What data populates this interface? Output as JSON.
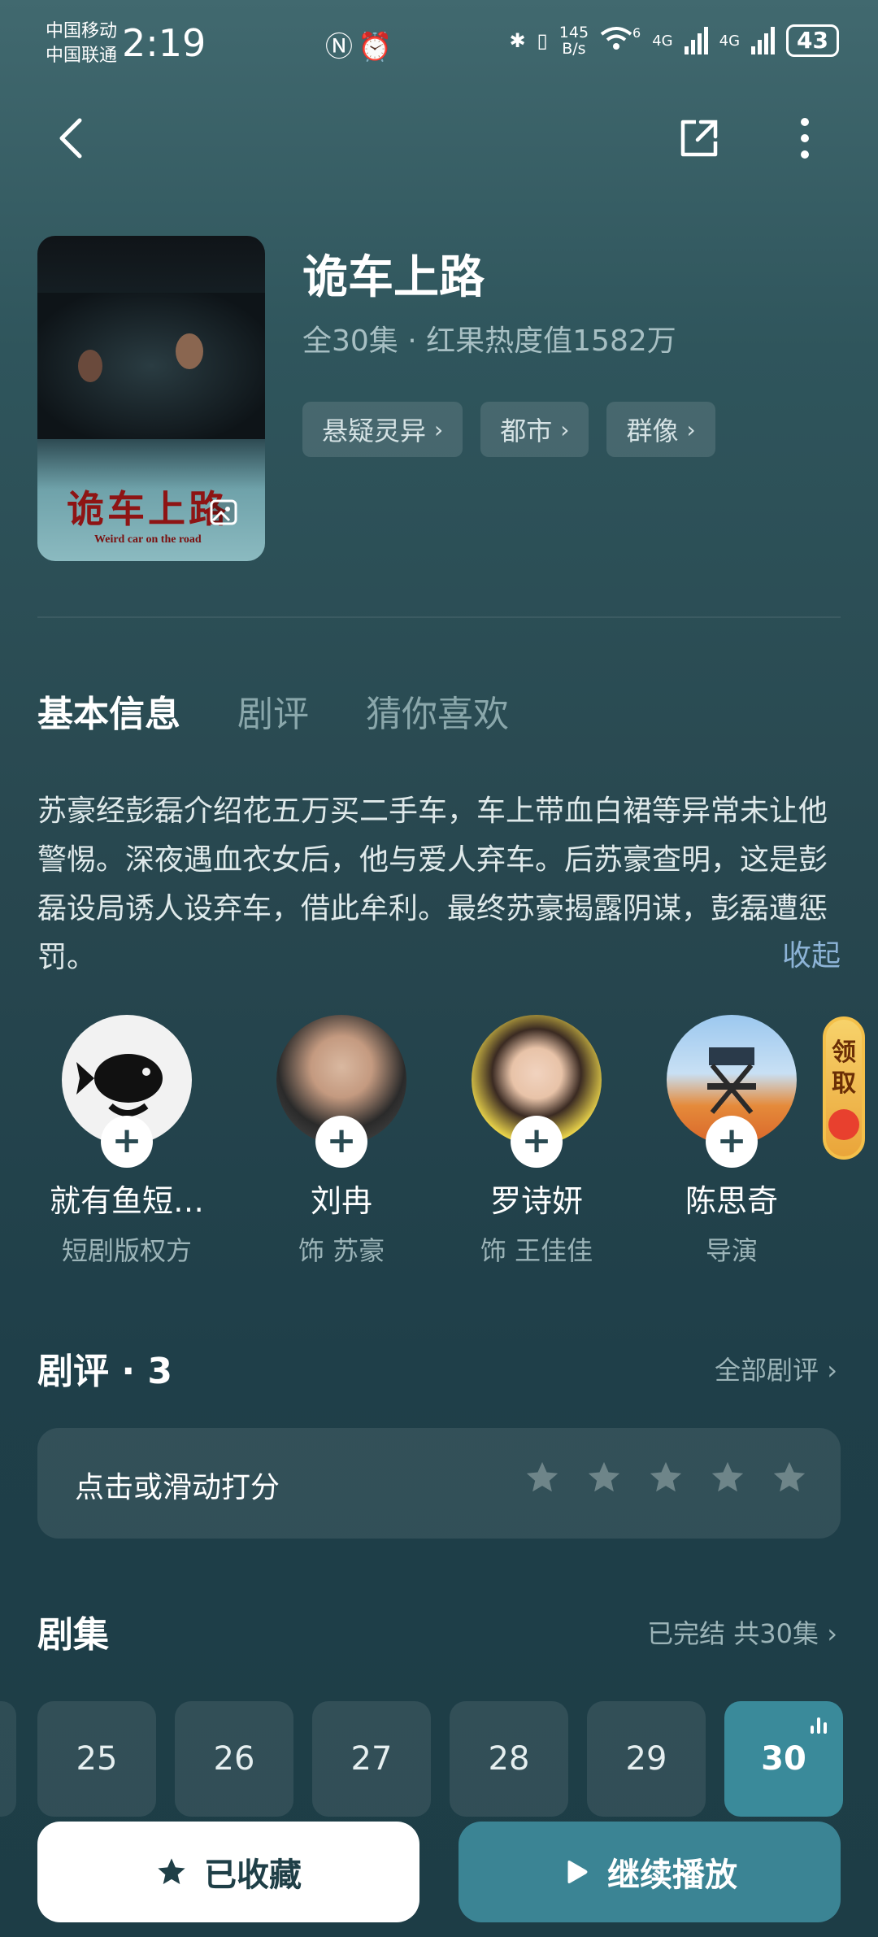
{
  "status_bar": {
    "carrier1": "中国移动",
    "carrier2": "中国联通",
    "time": "2:19",
    "net_speed_top": "145",
    "net_speed_bottom": "B/s",
    "wifi_label": "6",
    "sim1": "4G",
    "sim2": "4G",
    "battery": "43"
  },
  "show": {
    "title": "诡车上路",
    "meta": "全30集 · 红果热度值1582万",
    "poster_title": "诡车上路",
    "poster_subtitle": "Weird car on the road",
    "tags": [
      {
        "label": "悬疑灵异"
      },
      {
        "label": "都市"
      },
      {
        "label": "群像"
      }
    ]
  },
  "tabs": [
    {
      "label": "基本信息",
      "active": true
    },
    {
      "label": "剧评",
      "active": false
    },
    {
      "label": "猜你喜欢",
      "active": false
    }
  ],
  "synopsis": {
    "text": "苏豪经彭磊介绍花五万买二手车，车上带血白裙等异常未让他警惕。深夜遇血衣女后，他与爱人弃车。后苏豪查明，这是彭磊设局诱人设弃车，借此牟利。最终苏豪揭露阴谋，彭磊遭惩罚。",
    "collapse_label": "收起"
  },
  "cast": [
    {
      "name": "就有鱼短…",
      "role": "短剧版权方"
    },
    {
      "name": "刘冉",
      "role": "饰 苏豪"
    },
    {
      "name": "罗诗妍",
      "role": "饰 王佳佳"
    },
    {
      "name": "陈思奇",
      "role": "导演"
    }
  ],
  "reward": {
    "line1": "领",
    "line2": "取"
  },
  "reviews": {
    "title": "剧评 · 3",
    "all_link": "全部剧评 ›",
    "rate_prompt": "点击或滑动打分",
    "stars": 5
  },
  "episodes": {
    "title": "剧集",
    "status_link": "已完结 共30集 ›",
    "items": [
      {
        "num": "25",
        "active": false
      },
      {
        "num": "26",
        "active": false
      },
      {
        "num": "27",
        "active": false
      },
      {
        "num": "28",
        "active": false
      },
      {
        "num": "29",
        "active": false
      },
      {
        "num": "30",
        "active": true
      }
    ]
  },
  "actions": {
    "favorite_label": "已收藏",
    "play_label": "继续播放"
  },
  "colors": {
    "accent": "#3b8494",
    "active_episode": "#3a8a9a",
    "link": "#8cb3d6"
  }
}
